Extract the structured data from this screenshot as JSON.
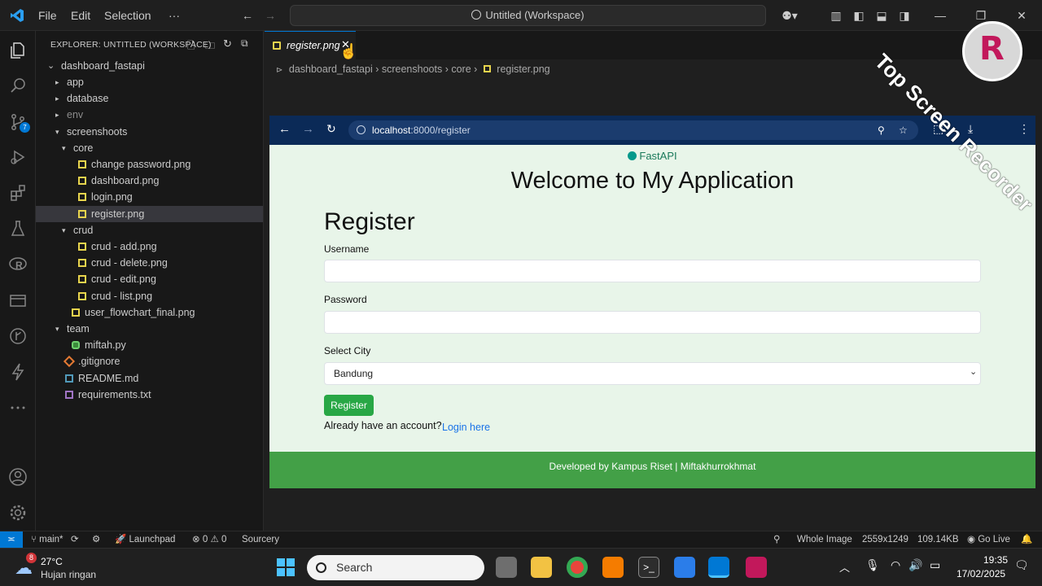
{
  "titlebar": {
    "menus": [
      "File",
      "Edit",
      "Selection",
      "···"
    ],
    "command_center": "Untitled (Workspace)"
  },
  "activity": {
    "scm_badge": "7"
  },
  "sidebar": {
    "title": "EXPLORER: UNTITLED (WORKSPACE)",
    "root": "dashboard_fastapi",
    "items": [
      {
        "label": "app",
        "depth": 1,
        "type": "folder"
      },
      {
        "label": "database",
        "depth": 1,
        "type": "folder"
      },
      {
        "label": "env",
        "depth": 1,
        "type": "folder-dim"
      },
      {
        "label": "screenshoots",
        "depth": 1,
        "type": "folder-open"
      },
      {
        "label": "core",
        "depth": 2,
        "type": "folder-open"
      },
      {
        "label": "change password.png",
        "depth": 3,
        "type": "png"
      },
      {
        "label": "dashboard.png",
        "depth": 3,
        "type": "png"
      },
      {
        "label": "login.png",
        "depth": 3,
        "type": "png"
      },
      {
        "label": "register.png",
        "depth": 3,
        "type": "png",
        "selected": true
      },
      {
        "label": "crud",
        "depth": 2,
        "type": "folder-open"
      },
      {
        "label": "crud - add.png",
        "depth": 3,
        "type": "png"
      },
      {
        "label": "crud - delete.png",
        "depth": 3,
        "type": "png"
      },
      {
        "label": "crud - edit.png",
        "depth": 3,
        "type": "png"
      },
      {
        "label": "crud - list.png",
        "depth": 3,
        "type": "png"
      },
      {
        "label": "user_flowchart_final.png",
        "depth": 2,
        "type": "png"
      },
      {
        "label": "team",
        "depth": 1,
        "type": "folder-open"
      },
      {
        "label": "miftah.py",
        "depth": 2,
        "type": "py"
      },
      {
        "label": ".gitignore",
        "depth": 1,
        "type": "git"
      },
      {
        "label": "README.md",
        "depth": 1,
        "type": "md"
      },
      {
        "label": "requirements.txt",
        "depth": 1,
        "type": "txt"
      }
    ]
  },
  "editor": {
    "tab_label": "register.png",
    "breadcrumb": [
      "dashboard_fastapi",
      "screenshoots",
      "core",
      "register.png"
    ]
  },
  "browser": {
    "url_host": "localhost",
    "url_path": ":8000/register",
    "brand": "FastAPI",
    "heading": "Welcome to My Application",
    "form_title": "Register",
    "username_label": "Username",
    "password_label": "Password",
    "city_label": "Select City",
    "city_value": "Bandung",
    "register_button": "Register",
    "account_text": "Already have an account?",
    "login_link": "Login here",
    "footer": "Developed by Kampus Riset | Miftakhurrokhmat"
  },
  "statusbar": {
    "branch": "main*",
    "launchpad": "Launchpad",
    "errors": "0",
    "warnings": "0",
    "sourcery": "Sourcery",
    "whole_image": "Whole Image",
    "dimensions": "2559x1249",
    "filesize": "109.14KB",
    "go_live": "Go Live"
  },
  "taskbar": {
    "weather_temp": "27°C",
    "weather_desc": "Hujan ringan",
    "weather_badge": "8",
    "search_placeholder": "Search",
    "time": "19:35",
    "date": "17/02/2025"
  },
  "watermark": "Top Screen Recorder",
  "colors": {
    "accent": "#0078d4",
    "browser_bg": "#e8f5e9",
    "button_green": "#28a745",
    "footer_green": "#43a047",
    "link_blue": "#1a73e8"
  }
}
